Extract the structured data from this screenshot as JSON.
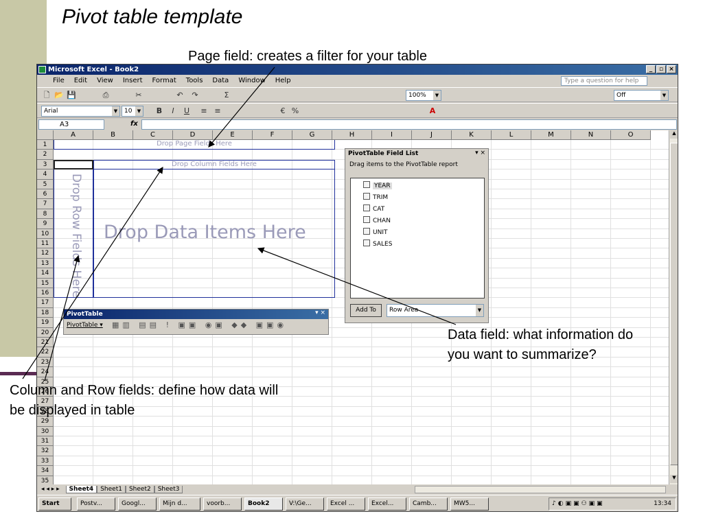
{
  "slide": {
    "title": "Pivot table template",
    "callout_page_field": "Page field: creates a filter for your table",
    "callout_data_field": [
      "Data field: what information do",
      "you want to summarize?"
    ],
    "callout_col_row": [
      "Column and Row fields: define how data will",
      "be displayed in table"
    ]
  },
  "excel": {
    "window_title": "Microsoft Excel - Book2",
    "menu": [
      "File",
      "Edit",
      "View",
      "Insert",
      "Format",
      "Tools",
      "Data",
      "Window",
      "Help"
    ],
    "help_placeholder": "Type a question for help",
    "zoom": "100%",
    "font_name": "Arial",
    "font_size": "10",
    "toolbar_off": "Off",
    "name_box": "A3",
    "fx": "fx",
    "columns": [
      "A",
      "B",
      "C",
      "D",
      "E",
      "F",
      "G",
      "H",
      "I",
      "J",
      "K",
      "L",
      "M",
      "N",
      "O"
    ],
    "rows": [
      "1",
      "2",
      "3",
      "4",
      "5",
      "6",
      "7",
      "8",
      "9",
      "10",
      "11",
      "12",
      "13",
      "14",
      "15",
      "16",
      "17",
      "18",
      "19",
      "20",
      "21",
      "22",
      "23",
      "24",
      "25",
      "26",
      "27",
      "28",
      "29",
      "30",
      "31",
      "32",
      "33",
      "34",
      "35"
    ],
    "drop_page": "Drop Page Fields Here",
    "drop_column": "Drop Column Fields Here",
    "drop_row": "Drop Row Fields Here",
    "drop_data": "Drop Data Items Here",
    "field_list": {
      "title": "PivotTable Field List",
      "instruction": "Drag items to the PivotTable report",
      "fields": [
        "YEAR",
        "TRIM",
        "CAT",
        "CHAN",
        "UNIT",
        "SALES"
      ],
      "add_to": "Add To",
      "area": "Row Area"
    },
    "pivot_toolbar": {
      "title": "PivotTable",
      "menu": "PivotTable ▾"
    },
    "sheets": [
      "Sheet4",
      "Sheet1",
      "Sheet2",
      "Sheet3"
    ],
    "active_sheet": "Sheet4"
  },
  "taskbar": {
    "start": "Start",
    "tasks": [
      "Postv...",
      "Googl...",
      "Mijn d...",
      "voorb...",
      "Book2",
      "V:\\Ge...",
      "Excel ...",
      "Excel...",
      "Camb...",
      "MW5..."
    ],
    "clock": "13:34"
  }
}
